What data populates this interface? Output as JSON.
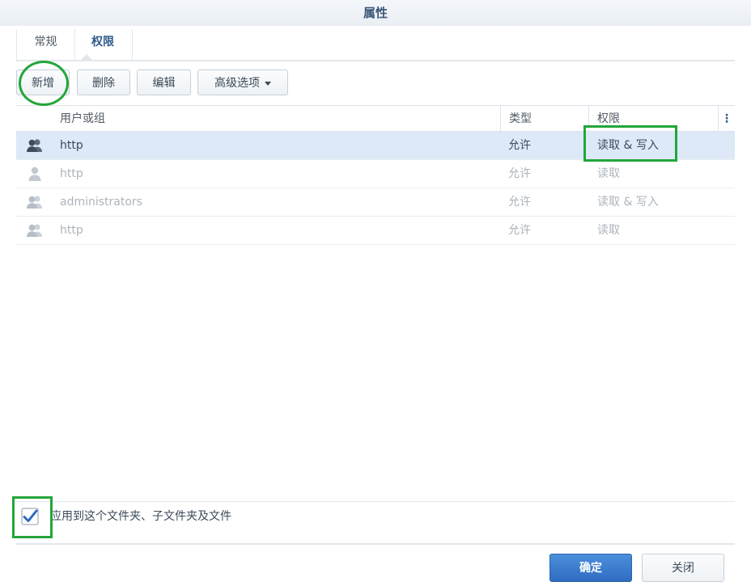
{
  "window": {
    "title": "属性"
  },
  "tabs": [
    {
      "label": "常规"
    },
    {
      "label": "权限"
    }
  ],
  "toolbar": {
    "add_label": "新增",
    "delete_label": "删除",
    "edit_label": "编辑",
    "advanced_label": "高级选项"
  },
  "grid": {
    "columns": {
      "user": "用户或组",
      "type": "类型",
      "permission": "权限"
    },
    "rows": [
      {
        "icon": "group-icon",
        "user": "http",
        "type": "允许",
        "permission": "读取 & 写入",
        "state": "selected"
      },
      {
        "icon": "user-icon",
        "user": "http",
        "type": "允许",
        "permission": "读取",
        "state": "inherited"
      },
      {
        "icon": "group-icon",
        "user": "administrators",
        "type": "允许",
        "permission": "读取 & 写入",
        "state": "inherited"
      },
      {
        "icon": "group-icon",
        "user": "http",
        "type": "允许",
        "permission": "读取",
        "state": "inherited"
      }
    ]
  },
  "apply": {
    "checked": true,
    "label": "应用到这个文件夹、子文件夹及文件"
  },
  "footer": {
    "ok_label": "确定",
    "close_label": "关闭"
  },
  "colors": {
    "accent": "#2f6cc0",
    "highlight": "#22a63a",
    "selected_row": "#dde9f7"
  }
}
